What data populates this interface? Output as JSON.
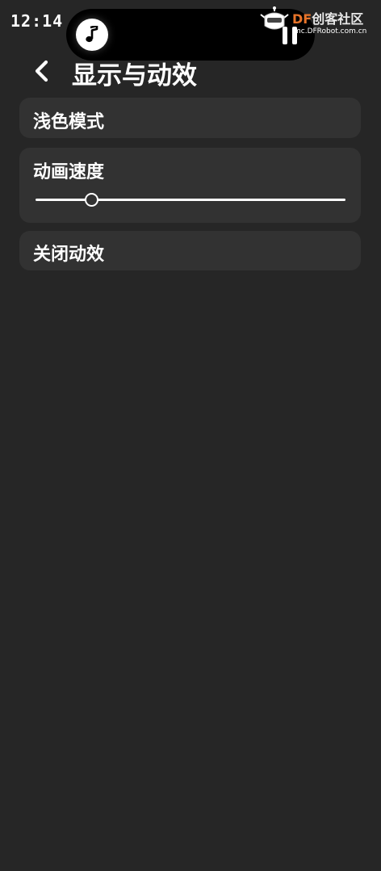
{
  "status_bar": {
    "time": "12:14"
  },
  "now_playing": {
    "icon": "music-note-icon",
    "control_icon": "pause-icon"
  },
  "watermark": {
    "brand_prefix": "DF",
    "brand_suffix": "创客社区",
    "url": "mc.DFRobot.com.cn",
    "brand_color": "#e8742a"
  },
  "header": {
    "back_icon": "chevron-left-icon",
    "title": "显示与动效"
  },
  "settings": {
    "light_mode": {
      "label": "浅色模式"
    },
    "animation_speed": {
      "label": "动画速度",
      "value_fraction": 0.18
    },
    "disable_animation": {
      "label": "关闭动效"
    }
  },
  "colors": {
    "background": "#262626",
    "card": "#323232",
    "text": "#ffffff"
  }
}
